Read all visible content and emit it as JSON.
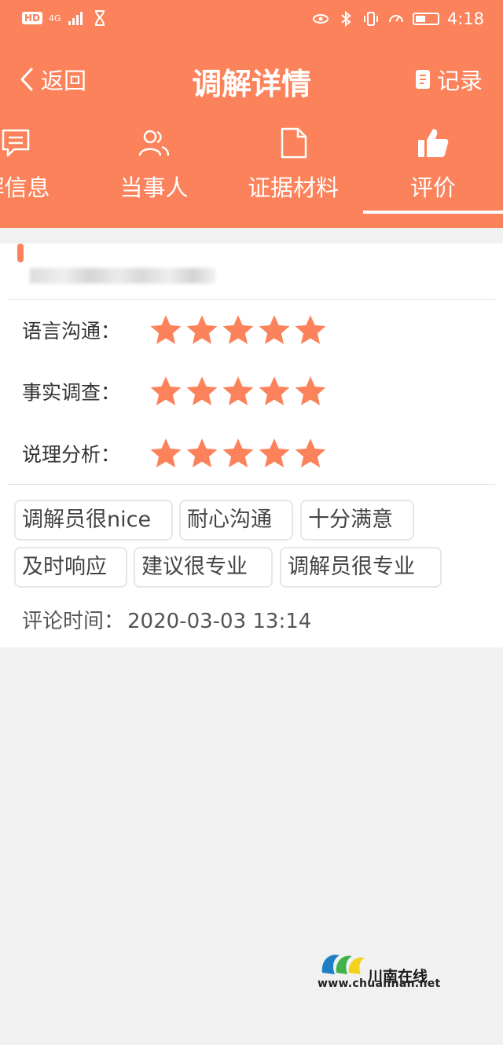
{
  "status_bar": {
    "hd": "HD",
    "network": "4G",
    "time": "4:18"
  },
  "nav": {
    "back_label": "返回",
    "title": "调解详情",
    "record_label": "记录"
  },
  "tabs": [
    {
      "label": "解信息",
      "icon": "message-icon",
      "active": false
    },
    {
      "label": "当事人",
      "icon": "users-icon",
      "active": false
    },
    {
      "label": "证据材料",
      "icon": "document-icon",
      "active": false
    },
    {
      "label": "评价",
      "icon": "thumbs-up-icon",
      "active": true
    }
  ],
  "ratings": [
    {
      "label": "语言沟通：",
      "stars": 5
    },
    {
      "label": "事实调查：",
      "stars": 5
    },
    {
      "label": "说理分析：",
      "stars": 5
    }
  ],
  "tags": [
    "调解员很nice",
    "耐心沟通",
    "十分满意",
    "及时响应",
    "建议很专业",
    "调解员很专业"
  ],
  "comment": {
    "time_label": "评论时间：",
    "time_value": "2020-03-03 13:14"
  },
  "watermark": {
    "title": "川南在线",
    "url": "www.chuannan.net"
  },
  "colors": {
    "accent": "#fb825a",
    "background": "#f1f1f1",
    "star": "#fb825a"
  }
}
